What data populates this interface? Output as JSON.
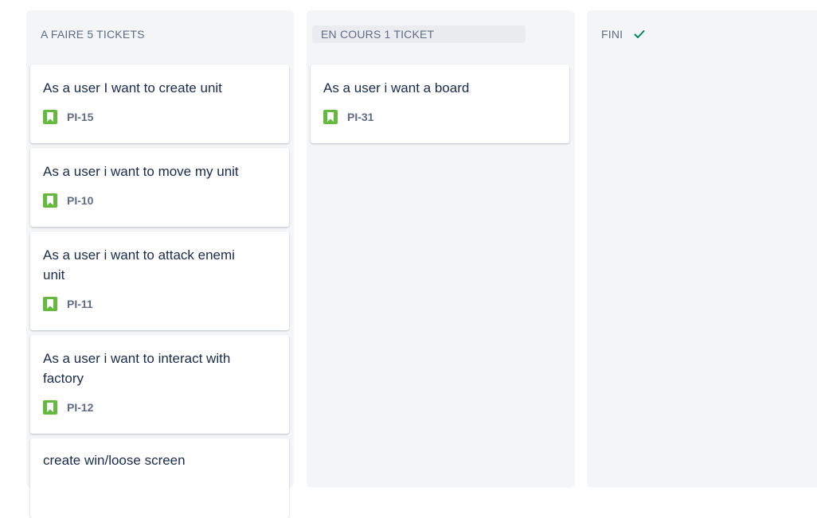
{
  "columns": [
    {
      "name": "A FAIRE",
      "count": "5 TICKETS",
      "cards": [
        {
          "title": "As a user I want to create unit",
          "key": "PI-15"
        },
        {
          "title": "As a user i want to move my unit",
          "key": "PI-10"
        },
        {
          "title": "As a user i want to attack enemi unit",
          "key": "PI-11"
        },
        {
          "title": "As a user i want to interact with factory",
          "key": "PI-12"
        },
        {
          "title": "create win/loose screen",
          "key": ""
        }
      ]
    },
    {
      "name": "EN COURS",
      "count": "1 TICKET",
      "cards": [
        {
          "title": "As a user i want a board",
          "key": "PI-31"
        }
      ]
    },
    {
      "name": "FINI",
      "count": "",
      "cards": []
    }
  ],
  "icons": {
    "story": "bookmark-icon",
    "done": "check-icon"
  },
  "colors": {
    "story_icon": "#63ba3c",
    "check": "#00875a",
    "column_bg": "#f4f5f7"
  }
}
